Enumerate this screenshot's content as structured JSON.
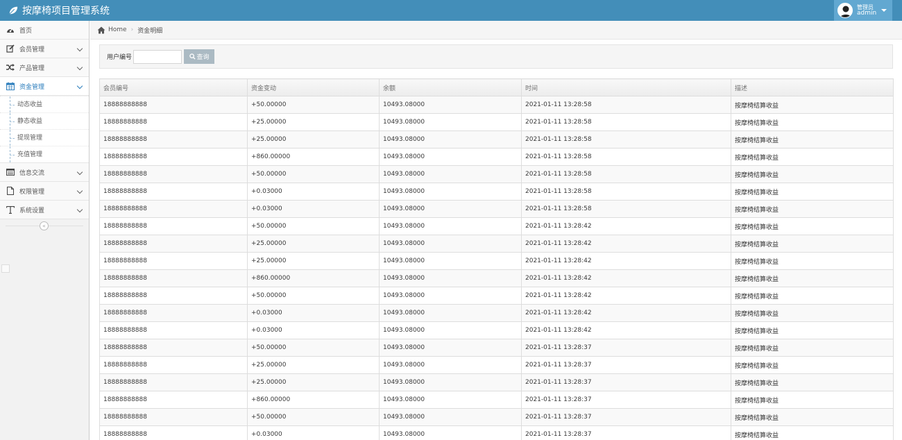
{
  "app": {
    "title": "按摩椅项目管理系统"
  },
  "user": {
    "role": "管理员",
    "name": "admin"
  },
  "sidebar": {
    "items": [
      {
        "label": "首页",
        "icon": "dashboard-icon"
      },
      {
        "label": "会员管理",
        "icon": "edit-icon"
      },
      {
        "label": "产品管理",
        "icon": "random-icon"
      },
      {
        "label": "资金管理",
        "icon": "calendar-icon",
        "active": true,
        "children": [
          {
            "label": "动态收益"
          },
          {
            "label": "静态收益"
          },
          {
            "label": "提现管理"
          },
          {
            "label": "充值管理"
          }
        ]
      },
      {
        "label": "信息交流",
        "icon": "list-icon"
      },
      {
        "label": "权限管理",
        "icon": "file-icon"
      },
      {
        "label": "系统设置",
        "icon": "text-icon"
      }
    ],
    "collapse_glyph": "«"
  },
  "breadcrumb": {
    "home": "Home",
    "current": "资金明细"
  },
  "search": {
    "label": "用户编号",
    "value": "",
    "placeholder": "",
    "button": "查询"
  },
  "table": {
    "headers": [
      "会员编号",
      "资金变动",
      "余额",
      "时间",
      "描述"
    ],
    "rows": [
      [
        "18888888888",
        "+50.00000",
        "10493.08000",
        "2021-01-11 13:28:58",
        "按摩椅结算收益"
      ],
      [
        "18888888888",
        "+25.00000",
        "10493.08000",
        "2021-01-11 13:28:58",
        "按摩椅结算收益"
      ],
      [
        "18888888888",
        "+25.00000",
        "10493.08000",
        "2021-01-11 13:28:58",
        "按摩椅结算收益"
      ],
      [
        "18888888888",
        "+860.00000",
        "10493.08000",
        "2021-01-11 13:28:58",
        "按摩椅结算收益"
      ],
      [
        "18888888888",
        "+50.00000",
        "10493.08000",
        "2021-01-11 13:28:58",
        "按摩椅结算收益"
      ],
      [
        "18888888888",
        "+0.03000",
        "10493.08000",
        "2021-01-11 13:28:58",
        "按摩椅结算收益"
      ],
      [
        "18888888888",
        "+0.03000",
        "10493.08000",
        "2021-01-11 13:28:58",
        "按摩椅结算收益"
      ],
      [
        "18888888888",
        "+50.00000",
        "10493.08000",
        "2021-01-11 13:28:42",
        "按摩椅结算收益"
      ],
      [
        "18888888888",
        "+25.00000",
        "10493.08000",
        "2021-01-11 13:28:42",
        "按摩椅结算收益"
      ],
      [
        "18888888888",
        "+25.00000",
        "10493.08000",
        "2021-01-11 13:28:42",
        "按摩椅结算收益"
      ],
      [
        "18888888888",
        "+860.00000",
        "10493.08000",
        "2021-01-11 13:28:42",
        "按摩椅结算收益"
      ],
      [
        "18888888888",
        "+50.00000",
        "10493.08000",
        "2021-01-11 13:28:42",
        "按摩椅结算收益"
      ],
      [
        "18888888888",
        "+0.03000",
        "10493.08000",
        "2021-01-11 13:28:42",
        "按摩椅结算收益"
      ],
      [
        "18888888888",
        "+0.03000",
        "10493.08000",
        "2021-01-11 13:28:42",
        "按摩椅结算收益"
      ],
      [
        "18888888888",
        "+50.00000",
        "10493.08000",
        "2021-01-11 13:28:37",
        "按摩椅结算收益"
      ],
      [
        "18888888888",
        "+25.00000",
        "10493.08000",
        "2021-01-11 13:28:37",
        "按摩椅结算收益"
      ],
      [
        "18888888888",
        "+25.00000",
        "10493.08000",
        "2021-01-11 13:28:37",
        "按摩椅结算收益"
      ],
      [
        "18888888888",
        "+860.00000",
        "10493.08000",
        "2021-01-11 13:28:37",
        "按摩椅结算收益"
      ],
      [
        "18888888888",
        "+50.00000",
        "10493.08000",
        "2021-01-11 13:28:37",
        "按摩椅结算收益"
      ],
      [
        "18888888888",
        "+0.03000",
        "10493.08000",
        "2021-01-11 13:28:37",
        "按摩椅结算收益"
      ]
    ]
  },
  "colors": {
    "navbar": "#438eb9",
    "user_menu": "#62a8d1",
    "active_link": "#2b7dbc",
    "search_button": "#abbac3"
  }
}
